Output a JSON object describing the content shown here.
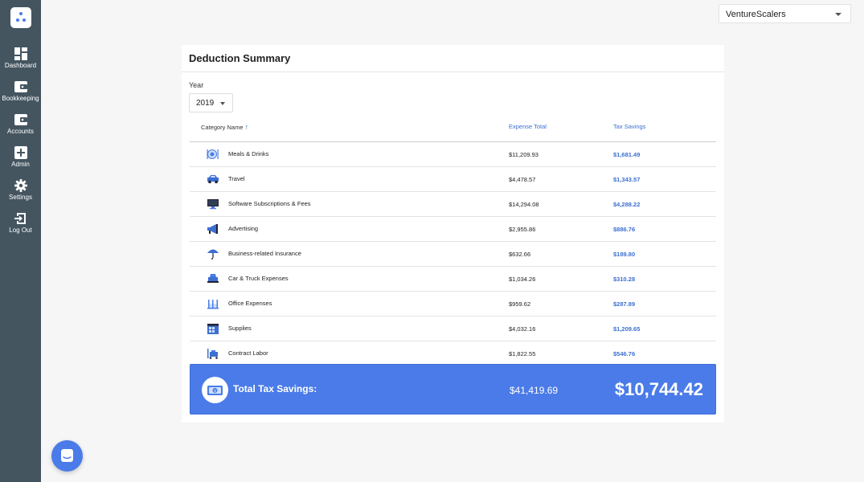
{
  "company": {
    "name": "VentureScalers"
  },
  "sidebar": {
    "items": [
      {
        "label": "Dashboard",
        "icon": "dashboard-icon"
      },
      {
        "label": "Bookkeeping",
        "icon": "wallet-icon"
      },
      {
        "label": "Accounts",
        "icon": "wallet-icon"
      },
      {
        "label": "Admin",
        "icon": "plus-box-icon"
      },
      {
        "label": "Settings",
        "icon": "gear-icon"
      },
      {
        "label": "Log Out",
        "icon": "logout-icon"
      }
    ]
  },
  "summary": {
    "title": "Deduction Summary",
    "year_label": "Year",
    "year_value": "2019",
    "columns": {
      "category": "Category Name",
      "expense": "Expense Total",
      "savings": "Tax Savings"
    },
    "rows": [
      {
        "name": "Meals & Drinks",
        "expense": "$11,209.93",
        "savings": "$1,681.49",
        "icon": "meals-icon"
      },
      {
        "name": "Travel",
        "expense": "$4,478.57",
        "savings": "$1,343.57",
        "icon": "car-icon"
      },
      {
        "name": "Software Subscriptions & Fees",
        "expense": "$14,294.08",
        "savings": "$4,288.22",
        "icon": "monitor-icon"
      },
      {
        "name": "Advertising",
        "expense": "$2,955.86",
        "savings": "$886.76",
        "icon": "megaphone-icon"
      },
      {
        "name": "Business-related Insurance",
        "expense": "$632.66",
        "savings": "$189.80",
        "icon": "umbrella-icon"
      },
      {
        "name": "Car & Truck Expenses",
        "expense": "$1,034.26",
        "savings": "$310.28",
        "icon": "truck-icon"
      },
      {
        "name": "Office Expenses",
        "expense": "$959.62",
        "savings": "$287.89",
        "icon": "office-icon"
      },
      {
        "name": "Supplies",
        "expense": "$4,032.16",
        "savings": "$1,209.65",
        "icon": "supplies-icon"
      },
      {
        "name": "Contract Labor",
        "expense": "$1,822.55",
        "savings": "$546.76",
        "icon": "labor-icon"
      }
    ],
    "total": {
      "label": "Total Tax Savings:",
      "expense": "$41,419.69",
      "savings": "$10,744.42"
    }
  },
  "colors": {
    "sidebar": "#445560",
    "accent": "#4a7be8",
    "link": "#3d6fd1"
  }
}
